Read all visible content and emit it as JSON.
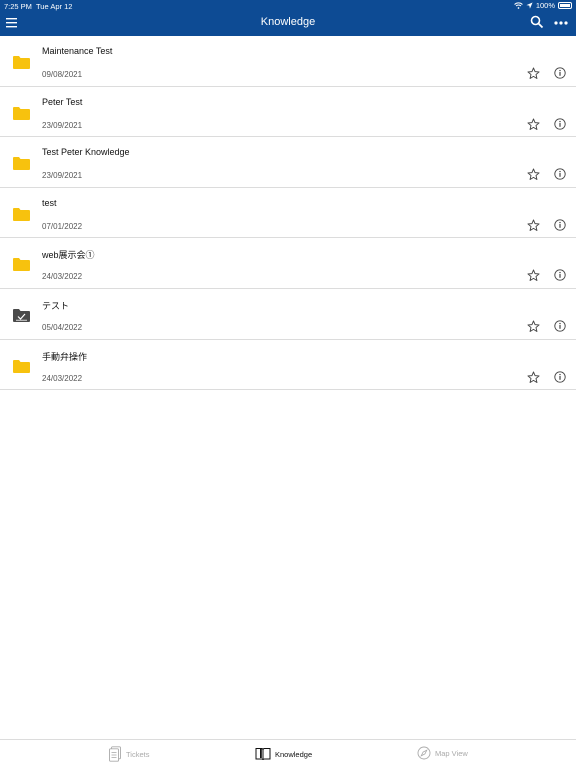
{
  "status_bar": {
    "time": "7:25 PM",
    "date": "Tue Apr 12",
    "battery": "100%"
  },
  "header": {
    "title": "Knowledge",
    "menu_icon": "hamburger-menu-icon",
    "search_icon": "search-icon",
    "more_icon": "more-dots-icon"
  },
  "colors": {
    "nav_bg": "#0d4b94",
    "folder": "#f7c20e",
    "folder_special": "#4a4a4a"
  },
  "items": [
    {
      "name": "Maintenance Test",
      "date": "09/08/2021",
      "icon": "folder-icon"
    },
    {
      "name": "Peter Test",
      "date": "23/09/2021",
      "icon": "folder-icon"
    },
    {
      "name": "Test Peter Knowledge",
      "date": "23/09/2021",
      "icon": "folder-icon"
    },
    {
      "name": "test",
      "date": "07/01/2022",
      "icon": "folder-icon"
    },
    {
      "name": "web展示会①",
      "date": "24/03/2022",
      "icon": "folder-icon"
    },
    {
      "name": "テスト",
      "date": "05/04/2022",
      "icon": "folder-check-icon"
    },
    {
      "name": "手動弁操作",
      "date": "24/03/2022",
      "icon": "folder-icon"
    }
  ],
  "tabs": [
    {
      "label": "Tickets",
      "icon": "tickets-icon",
      "active": false
    },
    {
      "label": "Knowledge",
      "icon": "book-icon",
      "active": true
    },
    {
      "label": "Map View",
      "icon": "compass-icon",
      "active": false
    }
  ]
}
